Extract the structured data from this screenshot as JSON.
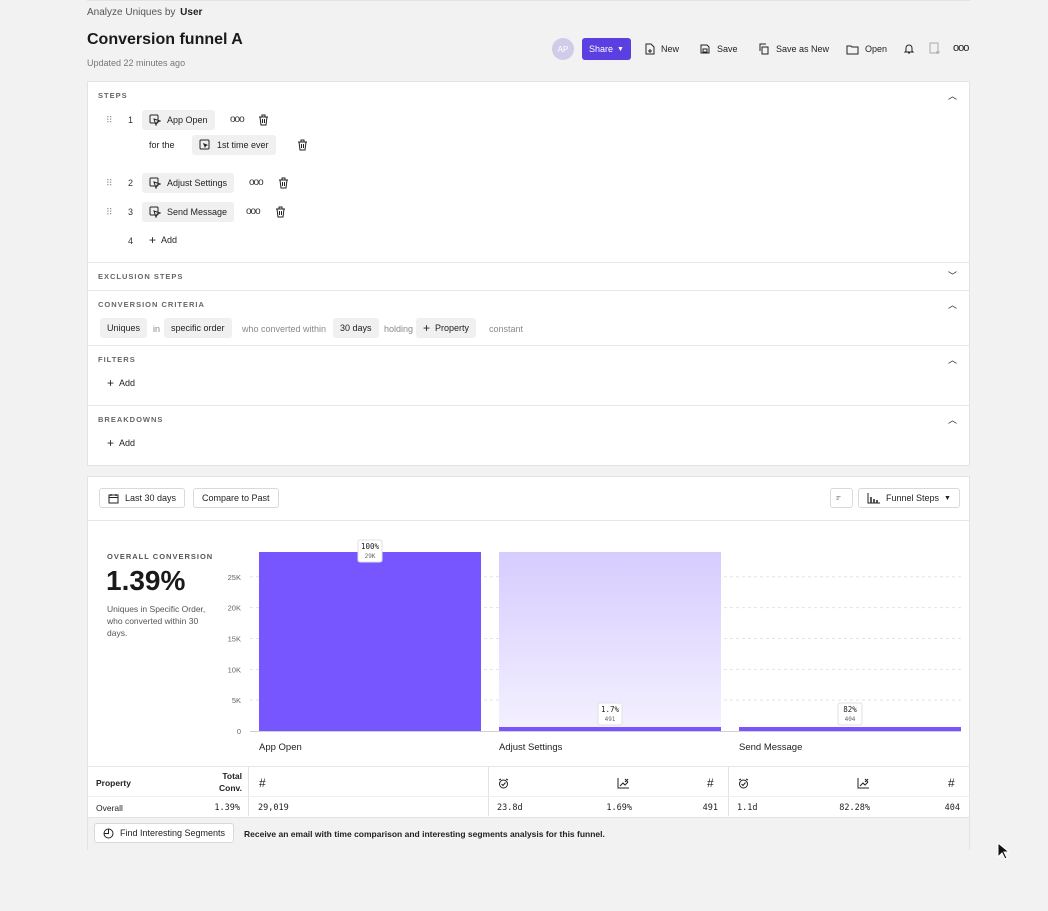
{
  "header": {
    "analyze_prefix": "Analyze Uniques by",
    "analyze_entity": "User",
    "title": "Conversion funnel A",
    "updated": "Updated 22 minutes ago",
    "avatar_initials": "AP",
    "share_label": "Share",
    "new_label": "New",
    "save_label": "Save",
    "save_as_new_label": "Save as New",
    "open_label": "Open"
  },
  "steps": {
    "heading": "STEPS",
    "items": [
      {
        "num": "1",
        "event": "App Open"
      },
      {
        "num": "2",
        "event": "Adjust Settings"
      },
      {
        "num": "3",
        "event": "Send Message"
      }
    ],
    "for_the": "for the",
    "frequency": "1st time ever",
    "next_num": "4",
    "add_label": "Add"
  },
  "exclusion": {
    "heading": "EXCLUSION STEPS"
  },
  "criteria": {
    "heading": "CONVERSION CRITERIA",
    "measure": "Uniques",
    "in": "in",
    "order": "specific order",
    "who": "who converted within",
    "window": "30 days",
    "holding": "holding",
    "property": "Property",
    "constant": "constant"
  },
  "filters": {
    "heading": "FILTERS",
    "add_label": "Add"
  },
  "breakdowns": {
    "heading": "BREAKDOWNS",
    "add_label": "Add"
  },
  "controls": {
    "date_range": "Last 30 days",
    "compare": "Compare to Past",
    "view": "Funnel Steps"
  },
  "summary": {
    "label": "OVERALL CONVERSION",
    "value": "1.39%",
    "description": "Uniques in Specific Order, who converted within 30 days."
  },
  "chart_data": {
    "type": "bar",
    "categories": [
      "App Open",
      "Adjust Settings",
      "Send Message"
    ],
    "values": [
      29019,
      491,
      404
    ],
    "ylim": [
      0,
      29019
    ],
    "yticks": [
      "0",
      "5K",
      "10K",
      "15K",
      "20K",
      "25K"
    ],
    "ytick_values": [
      0,
      5000,
      10000,
      15000,
      20000,
      25000
    ],
    "data_labels": [
      {
        "pct": "100%",
        "count": "29K"
      },
      {
        "pct": "1.7%",
        "count": "491"
      },
      {
        "pct": "82%",
        "count": "404"
      }
    ],
    "bar_color": "#7856ff",
    "ghost_color": "#d8d0ff",
    "grid": true
  },
  "table": {
    "property_header": "Property",
    "total_header": "Total Conv.",
    "row_label": "Overall",
    "total_value": "1.39%",
    "step1": {
      "count": "29,019"
    },
    "step2": {
      "time": "23.8d",
      "rate": "1.69%",
      "count": "491"
    },
    "step3": {
      "time": "1.1d",
      "rate": "82.28%",
      "count": "404"
    }
  },
  "footer": {
    "button": "Find Interesting Segments",
    "message": "Receive an email with time comparison and interesting segments analysis for this funnel."
  },
  "colors": {
    "accent": "#5b3fe0",
    "bar": "#7856ff"
  }
}
